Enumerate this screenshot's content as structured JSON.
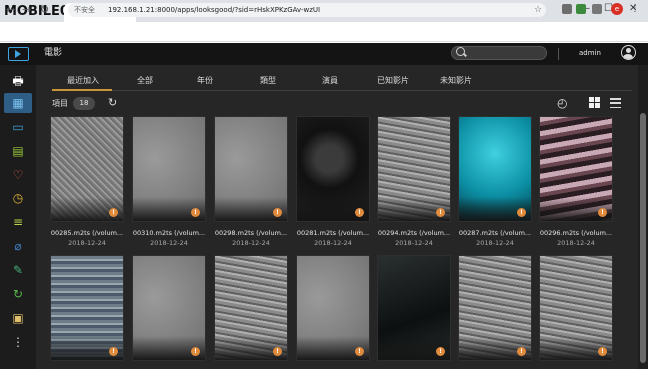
{
  "browser": {
    "watermark": "MOBILE01",
    "url_security": "不安全",
    "url": "192.168.1.21:8000/apps/looksgood/?sid=rHskXPKzGAv-wzUI",
    "profile_initial": "e"
  },
  "app": {
    "title": "電影",
    "user": "admin"
  },
  "categories": [
    "最近加入",
    "全部",
    "年份",
    "類型",
    "演員",
    "已知影片",
    "未知影片"
  ],
  "toolbar": {
    "items_label": "項目",
    "items_count": "18"
  },
  "tiles": [
    {
      "title": "00285.m2ts (/volum...",
      "date": "2018-12-24"
    },
    {
      "title": "00310.m2ts (/volum...",
      "date": "2018-12-24"
    },
    {
      "title": "00298.m2ts (/volum...",
      "date": "2018-12-24"
    },
    {
      "title": "00281.m2ts (/volum...",
      "date": "2018-12-24"
    },
    {
      "title": "00294.m2ts (/volum...",
      "date": "2018-12-24"
    },
    {
      "title": "00287.m2ts (/volum...",
      "date": "2018-12-24"
    },
    {
      "title": "00296.m2ts (/volum...",
      "date": "2018-12-24"
    }
  ],
  "icons": {
    "rail": [
      "printer-icon",
      "film-icon",
      "tv-icon",
      "video-library-icon",
      "heart-icon",
      "clock-icon",
      "playlist-icon",
      "tag-icon",
      "edit-icon",
      "history-360-icon",
      "folder-icon",
      "more-icon"
    ]
  },
  "colors": {
    "accent": "#c99434",
    "rail_active": "#2e5e85",
    "warning": "#e08a3c"
  }
}
